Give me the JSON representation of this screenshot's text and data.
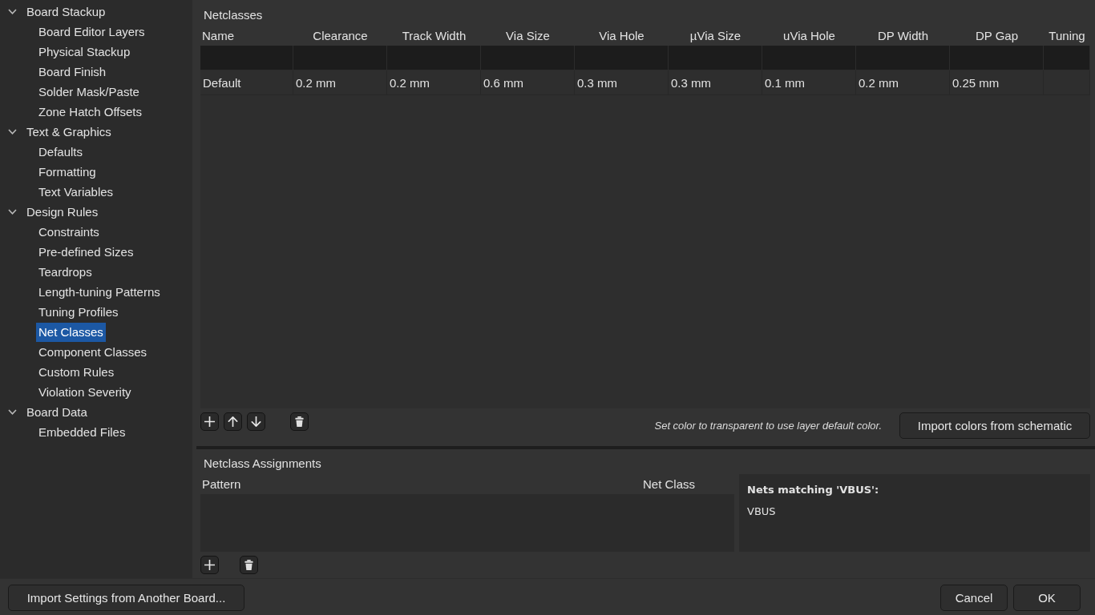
{
  "sidebar": {
    "items": [
      {
        "label": "Board Stackup",
        "expanded": true,
        "children": [
          {
            "label": "Board Editor Layers",
            "selected": false
          },
          {
            "label": "Physical Stackup",
            "selected": false
          },
          {
            "label": "Board Finish",
            "selected": false
          },
          {
            "label": "Solder Mask/Paste",
            "selected": false
          },
          {
            "label": "Zone Hatch Offsets",
            "selected": false
          }
        ]
      },
      {
        "label": "Text & Graphics",
        "expanded": true,
        "children": [
          {
            "label": "Defaults",
            "selected": false
          },
          {
            "label": "Formatting",
            "selected": false
          },
          {
            "label": "Text Variables",
            "selected": false
          }
        ]
      },
      {
        "label": "Design Rules",
        "expanded": true,
        "children": [
          {
            "label": "Constraints",
            "selected": false
          },
          {
            "label": "Pre-defined Sizes",
            "selected": false
          },
          {
            "label": "Teardrops",
            "selected": false
          },
          {
            "label": "Length-tuning Patterns",
            "selected": false
          },
          {
            "label": "Tuning Profiles",
            "selected": false
          },
          {
            "label": "Net Classes",
            "selected": true
          },
          {
            "label": "Component Classes",
            "selected": false
          },
          {
            "label": "Custom Rules",
            "selected": false
          },
          {
            "label": "Violation Severity",
            "selected": false
          }
        ]
      },
      {
        "label": "Board Data",
        "expanded": true,
        "children": [
          {
            "label": "Embedded Files",
            "selected": false
          }
        ]
      }
    ]
  },
  "netclasses": {
    "title": "Netclasses",
    "columns": [
      "Name",
      "Clearance",
      "Track Width",
      "Via Size",
      "Via Hole",
      "µVia Size",
      "uVia Hole",
      "DP Width",
      "DP Gap",
      "Tuning"
    ],
    "rows": [
      {
        "kind": "blank"
      },
      {
        "kind": "data",
        "cells": [
          "Default",
          "0.2 mm",
          "0.2 mm",
          "0.6 mm",
          "0.3 mm",
          "0.3 mm",
          "0.1 mm",
          "0.2 mm",
          "0.25 mm"
        ]
      }
    ],
    "toolbar": [
      {
        "kind": "add"
      },
      {
        "kind": "move_up"
      },
      {
        "kind": "move_down"
      },
      {
        "kind": "delete"
      }
    ],
    "hint": "Set color to transparent to use layer default color.",
    "import_button": "Import colors from schematic"
  },
  "assignments": {
    "title": "Netclass Assignments",
    "columns": [
      "Pattern",
      "Net Class"
    ],
    "toolbar": [
      {
        "kind": "add"
      },
      {
        "kind": "delete"
      }
    ]
  },
  "matching_nets": {
    "title": "Nets matching 'VBUS':",
    "nets": [
      "VBUS"
    ]
  },
  "footer": {
    "import_button": "Import Settings from Another Board...",
    "buttons": [
      "Cancel",
      "OK"
    ]
  }
}
